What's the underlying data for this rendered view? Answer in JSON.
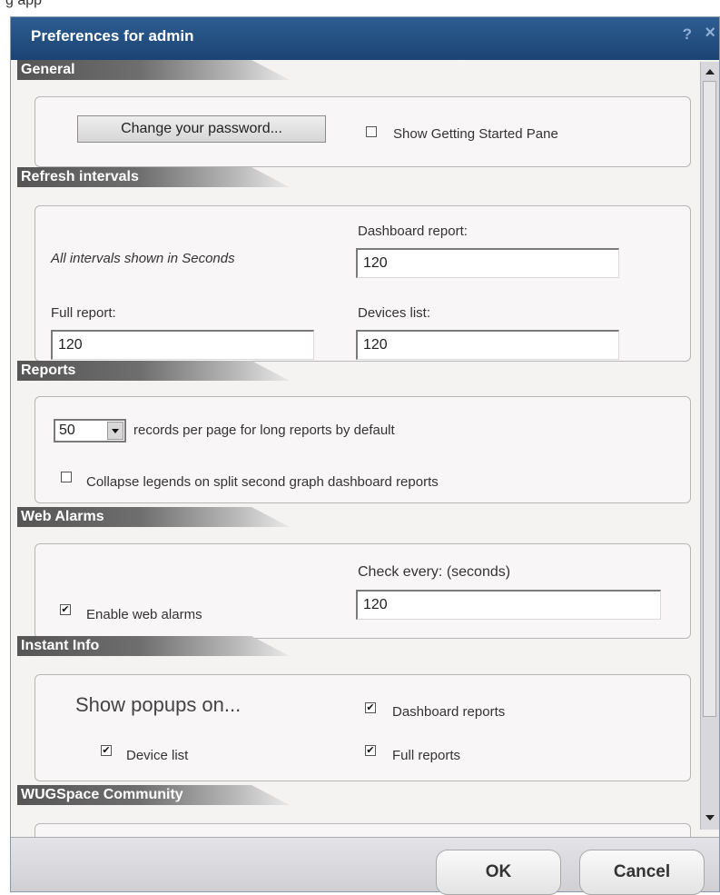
{
  "background_app": {
    "title": "g app"
  },
  "dialog": {
    "title": "Preferences for admin",
    "help_label": "?",
    "close_label": "×"
  },
  "sections": {
    "general": {
      "header": "General",
      "change_password_label": "Change your password...",
      "show_getting_started_label": "Show Getting Started Pane",
      "show_getting_started_checked": false
    },
    "refresh": {
      "header": "Refresh intervals",
      "note": "All intervals shown in Seconds",
      "dashboard_label": "Dashboard report:",
      "dashboard_value": "120",
      "full_label": "Full report:",
      "full_value": "120",
      "devices_label": "Devices list:",
      "devices_value": "120"
    },
    "reports": {
      "header": "Reports",
      "records_value": "50",
      "records_label": "records per page for long reports by default",
      "collapse_label": "Collapse legends on split second graph dashboard reports",
      "collapse_checked": false
    },
    "web_alarms": {
      "header": "Web Alarms",
      "check_label": "Check every: (seconds)",
      "check_value": "120",
      "enable_label": "Enable web alarms",
      "enable_checked": true
    },
    "instant_info": {
      "header": "Instant Info",
      "show_popups_label": "Show popups on...",
      "dashboard_label": "Dashboard reports",
      "dashboard_checked": true,
      "device_list_label": "Device list",
      "device_list_checked": true,
      "full_reports_label": "Full reports",
      "full_reports_checked": true
    },
    "wugspace": {
      "header": "WUGSpace Community"
    }
  },
  "footer": {
    "ok_label": "OK",
    "cancel_label": "Cancel"
  },
  "checkmark": "✔"
}
